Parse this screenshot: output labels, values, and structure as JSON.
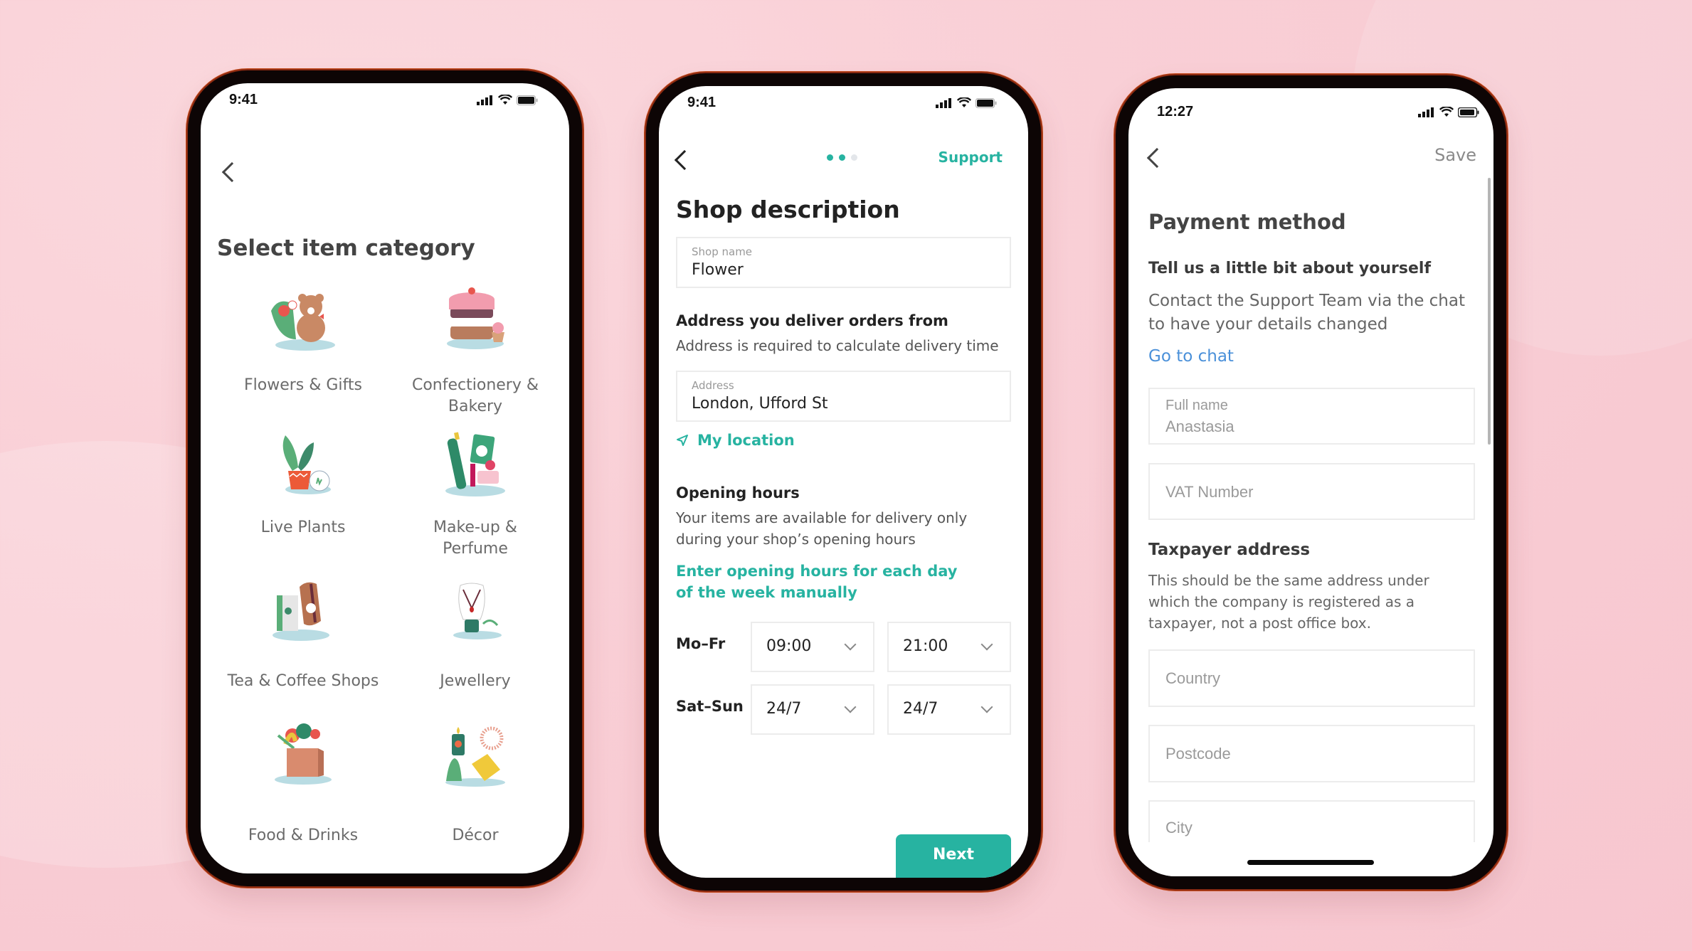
{
  "colors": {
    "accent": "#27b3a1",
    "link_blue": "#4a90d9",
    "background": "#f9cfd6",
    "phone_frame": "#0d0505"
  },
  "phone1": {
    "status_time": "9:41",
    "title": "Select item category",
    "categories": [
      {
        "label_line1": "Flowers & Gifts",
        "label_line2": "",
        "icon": "teddy-bear-flowers-icon"
      },
      {
        "label_line1": "Confectionery &",
        "label_line2": "Bakery",
        "icon": "cake-icon"
      },
      {
        "label_line1": "Live Plants",
        "label_line2": "",
        "icon": "potted-plant-icon"
      },
      {
        "label_line1": "Make-up &",
        "label_line2": "Perfume",
        "icon": "cosmetics-icon"
      },
      {
        "label_line1": "Tea & Coffee Shops",
        "label_line2": "",
        "icon": "tea-coffee-bags-icon"
      },
      {
        "label_line1": "Jewellery",
        "label_line2": "",
        "icon": "necklace-bust-icon"
      },
      {
        "label_line1": "Food & Drinks",
        "label_line2": "",
        "icon": "grocery-box-icon"
      },
      {
        "label_line1": "Décor",
        "label_line2": "",
        "icon": "decor-items-icon"
      }
    ]
  },
  "phone2": {
    "status_time": "9:41",
    "progress": {
      "current_step": 2,
      "total_steps": 3
    },
    "support_label": "Support",
    "title": "Shop description",
    "shop_name_field": {
      "label": "Shop name",
      "value": "Flower"
    },
    "address_section": {
      "heading": "Address you deliver orders from",
      "subtitle": "Address is required to calculate delivery time",
      "field": {
        "label": "Address",
        "value": "London, Ufford St"
      },
      "my_location_label": "My location"
    },
    "opening_hours": {
      "heading": "Opening hours",
      "body_line1": "Your items are available for delivery only",
      "body_line2": "during your shop’s opening hours",
      "link_line1": "Enter opening hours for each day",
      "link_line2": "of the week manually",
      "rows": [
        {
          "day": "Mo–Fr",
          "from": "09:00",
          "to": "21:00"
        },
        {
          "day": "Sat–Sun",
          "from": "24/7",
          "to": "24/7"
        }
      ]
    },
    "next_label": "Next"
  },
  "phone3": {
    "status_time": "12:27",
    "save_label": "Save",
    "title": "Payment method",
    "subtitle": "Tell us a little bit about yourself",
    "body_line1": "Contact the Support Team via the chat",
    "body_line2": "to have your details changed",
    "go_to_chat": "Go to chat",
    "full_name_field": {
      "label": "Full name",
      "value": "Anastasia"
    },
    "vat_placeholder": "VAT Number",
    "taxpayer": {
      "heading": "Taxpayer address",
      "line1": "This should be the same address under",
      "line2": "which the company is registered as a",
      "line3": "taxpayer, not a post office box."
    },
    "country_placeholder": "Country",
    "postcode_placeholder": "Postcode",
    "city_placeholder": "City"
  }
}
